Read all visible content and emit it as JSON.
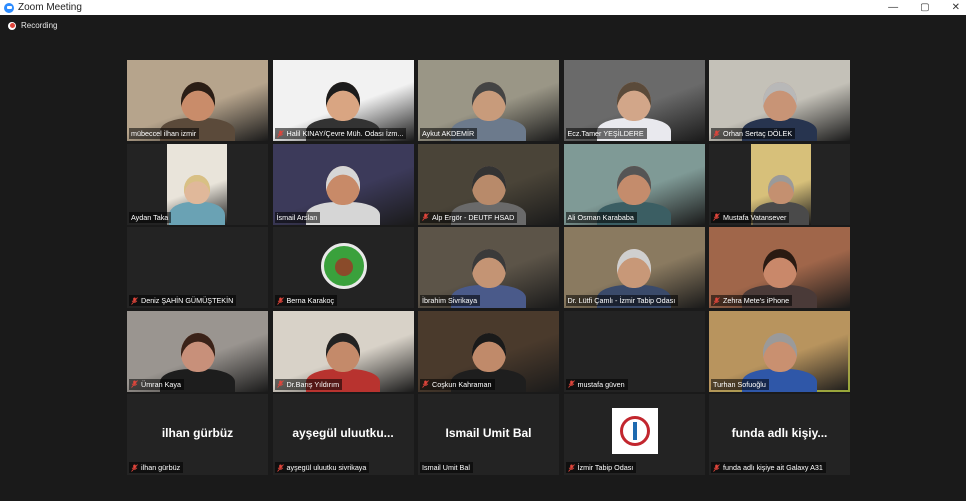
{
  "window": {
    "title": "Zoom Meeting",
    "controls": {
      "minimize": "—",
      "maximize": "▢",
      "close": "✕"
    }
  },
  "recording": {
    "label": "Recording"
  },
  "colors": {
    "accent_active": "#c8e04a",
    "muted_mic": "#e0453b",
    "recording": "#e0453b"
  },
  "participants": [
    {
      "name": "mübeccel ilhan izmir",
      "muted": false,
      "bg": "#b6a48c",
      "skin": "#c98c6a",
      "hair": "#2a1d15",
      "shirt": "#5b4a3a",
      "active": false
    },
    {
      "name": "Halil KINAY/Çevre Müh. Odası İzm...",
      "muted": true,
      "bg": "#f2f2f2",
      "skin": "#d9a582",
      "hair": "#1c1c1c",
      "shirt": "#333333",
      "active": false
    },
    {
      "name": "Aykut AKDEMİR",
      "muted": false,
      "bg": "#9a9686",
      "skin": "#c89b7b",
      "hair": "#444444",
      "shirt": "#6c7a8c",
      "active": false
    },
    {
      "name": "Ecz.Tamer YEŞİLDERE",
      "muted": false,
      "bg": "#6a6a6a",
      "skin": "#d2a689",
      "hair": "#5a4a3a",
      "shirt": "#e9e9ee",
      "active": false
    },
    {
      "name": "Orhan Sertaç DÖLEK",
      "muted": true,
      "bg": "#c4c1b8",
      "skin": "#c89476",
      "hair": "#b8b8b8",
      "shirt": "#27344f",
      "active": false
    },
    {
      "name": "Aydan Taka",
      "muted": false,
      "bg": "#e9e4da",
      "skin": "#e0b89a",
      "hair": "#d8c084",
      "shirt": "#6aa2b4",
      "active": false
    },
    {
      "name": "İsmail Arslan",
      "muted": false,
      "bg": "#3c3a5a",
      "skin": "#c88a68",
      "hair": "#d6d6d6",
      "shirt": "#d6d6d6",
      "active": false
    },
    {
      "name": "Alp Ergör - DEUTF HSAD",
      "muted": true,
      "bg": "#4a4438",
      "skin": "#b88a6a",
      "hair": "#333333",
      "shirt": "#6a6a6a",
      "active": false
    },
    {
      "name": "Ali Osman Karababa",
      "muted": false,
      "bg": "#7f9a96",
      "skin": "#c48c6c",
      "hair": "#555555",
      "shirt": "#3b5e63",
      "active": false
    },
    {
      "name": "Mustafa Vatansever",
      "muted": true,
      "bg": "#d7c07a",
      "skin": "#c49070",
      "hair": "#9a9a9a",
      "shirt": "#4a4a4a",
      "active": false
    },
    {
      "name": "Deniz ŞAHİN GÜMÜŞTEKİN",
      "muted": true,
      "active": false
    },
    {
      "name": "Berna Karakoç",
      "muted": true,
      "active": false
    },
    {
      "name": "İbrahim Sivrikaya",
      "muted": false,
      "bg": "#5c5448",
      "skin": "#c49474",
      "hair": "#3a3a3a",
      "shirt": "#4a5a8a",
      "active": false
    },
    {
      "name": "Dr. Lütfi Çamlı - İzmir Tabip Odası",
      "muted": false,
      "bg": "#8a7a60",
      "skin": "#c89878",
      "hair": "#cfcfcf",
      "shirt": "#3a4a6a",
      "active": false
    },
    {
      "name": "Zehra Mete's iPhone",
      "muted": true,
      "bg": "#a0664a",
      "skin": "#c9886a",
      "hair": "#2a1a12",
      "shirt": "#4a3a38",
      "active": false
    },
    {
      "name": "Ümran Kaya",
      "muted": true,
      "bg": "#9a9590",
      "skin": "#c8907a",
      "hair": "#3a2218",
      "shirt": "#1d1d1d",
      "active": false
    },
    {
      "name": "Dr.Barış Yıldırım",
      "muted": true,
      "bg": "#d8d2c8",
      "skin": "#c48a6a",
      "hair": "#222222",
      "shirt": "#b8332f",
      "active": false
    },
    {
      "name": "Coşkun Kahraman",
      "muted": true,
      "bg": "#4a3a2c",
      "skin": "#c08a6a",
      "hair": "#1a1a1a",
      "shirt": "#1e1e1e",
      "active": false
    },
    {
      "name": "mustafa güven",
      "muted": true,
      "active": false
    },
    {
      "name": "Turhan Sofuoğlu",
      "muted": false,
      "bg": "#b8945e",
      "skin": "#c99070",
      "hair": "#9a9a9a",
      "shirt": "#2f57a8",
      "active": true
    },
    {
      "name": "ilhan gürbüz",
      "muted": true,
      "big": "ilhan gürbüz",
      "active": false
    },
    {
      "name": "ayşegül uluutku sivrikaya",
      "muted": true,
      "big": "ayşegül uluutku...",
      "active": false
    },
    {
      "name": "Ismail Umit Bal",
      "muted": false,
      "big": "Ismail Umit Bal",
      "active": false
    },
    {
      "name": "İzmir Tabip Odası",
      "muted": true,
      "active": false
    },
    {
      "name": "funda adlı kişiye ait Galaxy A31",
      "muted": true,
      "big": "funda adlı kişiy...",
      "active": false
    }
  ]
}
